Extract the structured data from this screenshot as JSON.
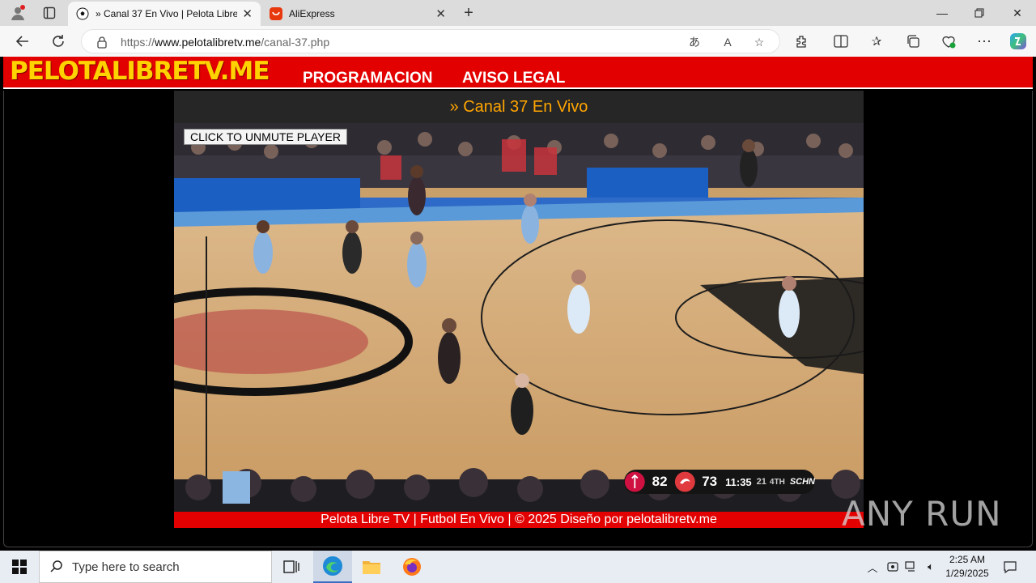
{
  "browser": {
    "tabs": [
      {
        "title": "» Canal 37 En Vivo | Pelota Libre TV",
        "active": true,
        "favicon": "soccer-ball-icon"
      },
      {
        "title": "AliExpress",
        "active": false,
        "favicon": "aliexpress-icon"
      }
    ],
    "url_prefix": "https://",
    "url_domain": "www.pelotalibretv.me",
    "url_path": "/canal-37.php"
  },
  "site": {
    "logo": "PELOTALIBRETV.ME",
    "menu": [
      "PROGRAMACION",
      "AVISO LEGAL"
    ],
    "channel_title": "» Canal 37 En Vivo",
    "unmute_label": "CLICK TO UNMUTE PLAYER",
    "footer": "Pelota Libre TV | Futbol En Vivo | © 2025 Diseño por pelotalibretv.me",
    "colors": {
      "brand_red": "#e30000",
      "logo_yellow": "#ffd200",
      "title_orange": "#ffa500"
    }
  },
  "scoreboard": {
    "home_score": "82",
    "away_score": "73",
    "clock": "11:35",
    "shot_clock": "21",
    "period": "4TH",
    "network": "SCHN"
  },
  "watermark": "ANY RUN",
  "taskbar": {
    "search_placeholder": "Type here to search",
    "time": "2:25 AM",
    "date": "1/29/2025"
  }
}
